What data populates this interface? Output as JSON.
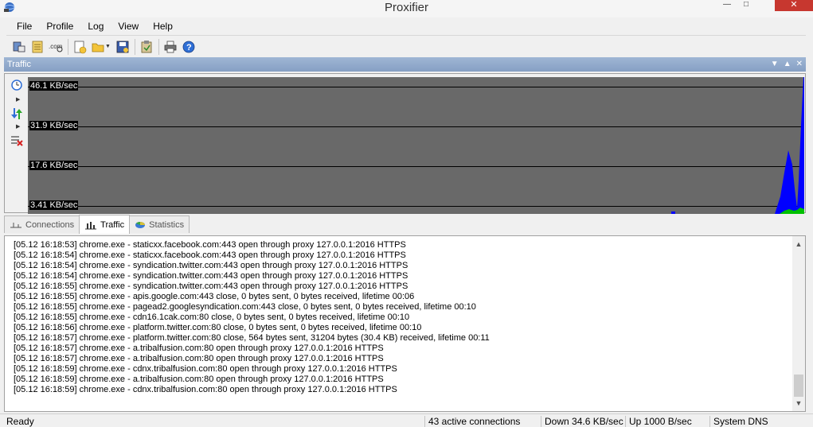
{
  "window": {
    "title": "Proxifier"
  },
  "menu": [
    "File",
    "Profile",
    "Log",
    "View",
    "Help"
  ],
  "panel": {
    "title": "Traffic"
  },
  "graph": {
    "labels": [
      "46.1 KB/sec",
      "31.9 KB/sec",
      "17.6 KB/sec",
      "3.41 KB/sec"
    ]
  },
  "tabs": [
    "Connections",
    "Traffic",
    "Statistics"
  ],
  "log": [
    "[05.12 16:18:53] chrome.exe - staticxx.facebook.com:443 open through proxy 127.0.0.1:2016 HTTPS",
    "[05.12 16:18:54] chrome.exe - staticxx.facebook.com:443 open through proxy 127.0.0.1:2016 HTTPS",
    "[05.12 16:18:54] chrome.exe - syndication.twitter.com:443 open through proxy 127.0.0.1:2016 HTTPS",
    "[05.12 16:18:54] chrome.exe - syndication.twitter.com:443 open through proxy 127.0.0.1:2016 HTTPS",
    "[05.12 16:18:55] chrome.exe - syndication.twitter.com:443 open through proxy 127.0.0.1:2016 HTTPS",
    "[05.12 16:18:55] chrome.exe - apis.google.com:443 close, 0 bytes sent, 0 bytes received, lifetime 00:06",
    "[05.12 16:18:55] chrome.exe - pagead2.googlesyndication.com:443 close, 0 bytes sent, 0 bytes received, lifetime 00:10",
    "[05.12 16:18:55] chrome.exe - cdn16.1cak.com:80 close, 0 bytes sent, 0 bytes received, lifetime 00:10",
    "[05.12 16:18:56] chrome.exe - platform.twitter.com:80 close, 0 bytes sent, 0 bytes received, lifetime 00:10",
    "[05.12 16:18:57] chrome.exe - platform.twitter.com:80 close, 564 bytes sent, 31204 bytes (30.4 KB) received, lifetime 00:11",
    "[05.12 16:18:57] chrome.exe - a.tribalfusion.com:80 open through proxy 127.0.0.1:2016 HTTPS",
    "[05.12 16:18:57] chrome.exe - a.tribalfusion.com:80 open through proxy 127.0.0.1:2016 HTTPS",
    "[05.12 16:18:59] chrome.exe - cdnx.tribalfusion.com:80 open through proxy 127.0.0.1:2016 HTTPS",
    "[05.12 16:18:59] chrome.exe - a.tribalfusion.com:80 open through proxy 127.0.0.1:2016 HTTPS",
    "[05.12 16:18:59] chrome.exe - cdnx.tribalfusion.com:80 open through proxy 127.0.0.1:2016 HTTPS"
  ],
  "status": {
    "ready": "Ready",
    "connections": "43 active connections",
    "down": "Down 34.6 KB/sec",
    "up": "Up 1000 B/sec",
    "dns": "System DNS"
  },
  "colors": {
    "graph_bg": "#696969",
    "download": "#0000ff",
    "upload": "#00c000",
    "panel_header": "#869fc4"
  }
}
